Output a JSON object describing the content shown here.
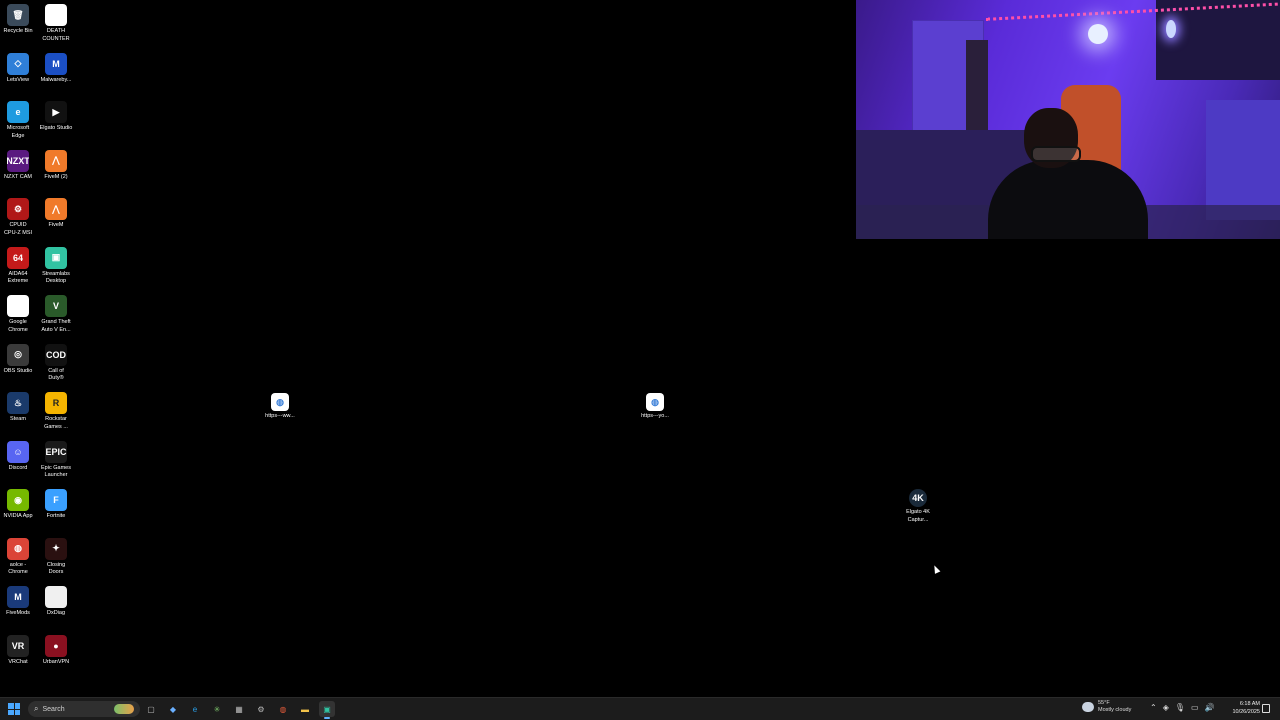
{
  "desktop": {
    "icons": [
      {
        "label": "Recycle Bin",
        "glyph": "🗑",
        "bg": "#3a4a5a"
      },
      {
        "label": "DEATH\nCOUNTER",
        "glyph": "",
        "bg": "#ffffff"
      },
      {
        "label": "LetsView",
        "glyph": "◇",
        "bg": "#2f7fd8"
      },
      {
        "label": "Malwareby...",
        "glyph": "M",
        "bg": "#1b4fc4"
      },
      {
        "label": "Microsoft\nEdge",
        "glyph": "e",
        "bg": "#1e9be0"
      },
      {
        "label": "Elgato Studio",
        "glyph": "▶",
        "bg": "#111111"
      },
      {
        "label": "NZXT CAM",
        "glyph": "NZXT",
        "bg": "#5a1a80"
      },
      {
        "label": "FiveM (2)",
        "glyph": "⋀",
        "bg": "#f07a2a"
      },
      {
        "label": "CPUID\nCPU-Z MSI",
        "glyph": "⚙",
        "bg": "#b01818"
      },
      {
        "label": "FiveM",
        "glyph": "⋀",
        "bg": "#f07a2a"
      },
      {
        "label": "AIDA64\nExtreme",
        "glyph": "64",
        "bg": "#c41a1a"
      },
      {
        "label": "Streamlabs\nDesktop",
        "glyph": "▣",
        "bg": "#31c3a2"
      },
      {
        "label": "Google\nChrome",
        "glyph": "",
        "bg": "#ffffff"
      },
      {
        "label": "Grand Theft\nAuto V En...",
        "glyph": "V",
        "bg": "#2a5a2a"
      },
      {
        "label": "OBS Studio",
        "glyph": "◎",
        "bg": "#3a3a3a"
      },
      {
        "label": "Call of\nDuty®",
        "glyph": "COD",
        "bg": "#111111"
      },
      {
        "label": "Steam",
        "glyph": "♨",
        "bg": "#1a3a6a"
      },
      {
        "label": "Rockstar\nGames ...",
        "glyph": "R",
        "bg": "#f5b400"
      },
      {
        "label": "Discord",
        "glyph": "☺",
        "bg": "#5865f2"
      },
      {
        "label": "Epic Games\nLauncher",
        "glyph": "EPIC",
        "bg": "#1a1a1a"
      },
      {
        "label": "NVIDIA App",
        "glyph": "◉",
        "bg": "#76b900"
      },
      {
        "label": "Fortnite",
        "glyph": "F",
        "bg": "#3aa0ff"
      },
      {
        "label": "aolce -\nChrome",
        "glyph": "◍",
        "bg": "#db4437"
      },
      {
        "label": "Closing\nDoors",
        "glyph": "✦",
        "bg": "#2a1010"
      },
      {
        "label": "FiveMods",
        "glyph": "M",
        "bg": "#1a3a7a"
      },
      {
        "label": "DxDiag",
        "glyph": "",
        "bg": "#f0f0f0"
      },
      {
        "label": "VRChat",
        "glyph": "VR",
        "bg": "#222222"
      },
      {
        "label": "UrbanVPN",
        "glyph": "●",
        "bg": "#8a1020"
      }
    ],
    "loose_icons": [
      {
        "label": "https---ww...",
        "glyph": "◍",
        "bg": "#ffffff"
      },
      {
        "label": "https---yo...",
        "glyph": "◍",
        "bg": "#ffffff"
      },
      {
        "label": "Elgato 4K\nCaptur...",
        "glyph": "4K",
        "bg": "#1a2a3a"
      }
    ]
  },
  "taskbar": {
    "search_placeholder": "Search",
    "apps": [
      {
        "name": "task-view",
        "glyph": "▢"
      },
      {
        "name": "copilot",
        "glyph": "◆"
      },
      {
        "name": "edge",
        "glyph": "e"
      },
      {
        "name": "app-green",
        "glyph": "✳"
      },
      {
        "name": "store",
        "glyph": "▦"
      },
      {
        "name": "settings",
        "glyph": "⚙"
      },
      {
        "name": "chrome",
        "glyph": "◍"
      },
      {
        "name": "file-explorer",
        "glyph": "▬"
      },
      {
        "name": "streamlabs",
        "glyph": "▣"
      }
    ],
    "weather_temp": "55°F",
    "weather_desc": "Mostly cloudy",
    "time": "6:18 AM",
    "date": "10/26/2025"
  }
}
